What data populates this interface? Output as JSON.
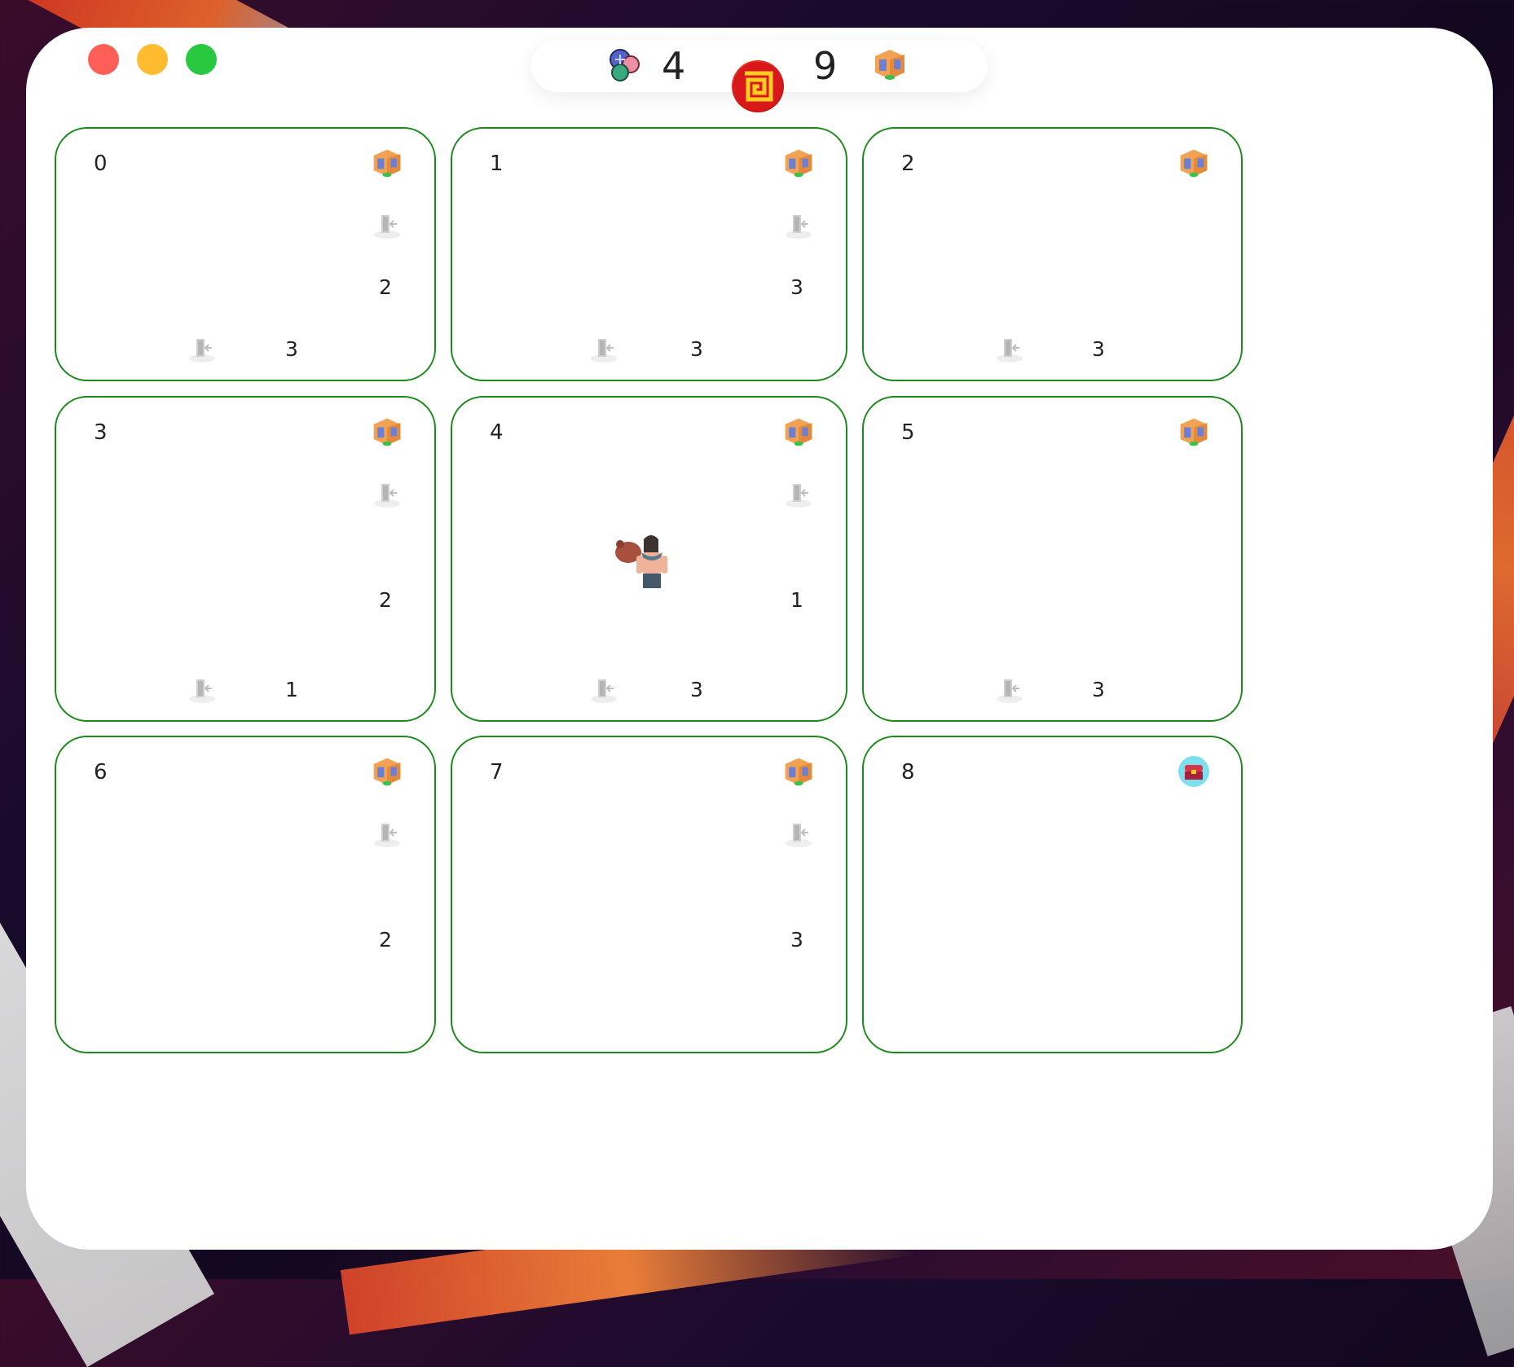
{
  "hud": {
    "gems_count": "4",
    "gems_icon": "gem-cluster-icon",
    "logo_icon": "maze-logo-icon",
    "rooms_count": "9",
    "rooms_icon": "room-cube-icon"
  },
  "window_controls": [
    "close",
    "minimize",
    "maximize"
  ],
  "rooms": [
    {
      "label": "0",
      "icon": "room-cube-icon",
      "east_door": "2",
      "south_door": "3"
    },
    {
      "label": "1",
      "icon": "room-cube-icon",
      "east_door": "3",
      "south_door": "3"
    },
    {
      "label": "2",
      "icon": "room-cube-icon",
      "south_door": "3"
    },
    {
      "label": "3",
      "icon": "room-cube-icon",
      "east_door": "2",
      "south_door": "1"
    },
    {
      "label": "4",
      "icon": "room-cube-icon",
      "east_door": "1",
      "south_door": "3",
      "occupant": "hero-character-icon"
    },
    {
      "label": "5",
      "icon": "room-cube-icon",
      "south_door": "3"
    },
    {
      "label": "6",
      "icon": "room-cube-icon",
      "east_door": "2"
    },
    {
      "label": "7",
      "icon": "room-cube-icon",
      "east_door": "3"
    },
    {
      "label": "8",
      "icon": "treasure-chest-icon"
    }
  ],
  "colors": {
    "room_border": "#1b8a1b",
    "close": "#ff5f57",
    "minimize": "#febc2e",
    "maximize": "#28c840"
  }
}
